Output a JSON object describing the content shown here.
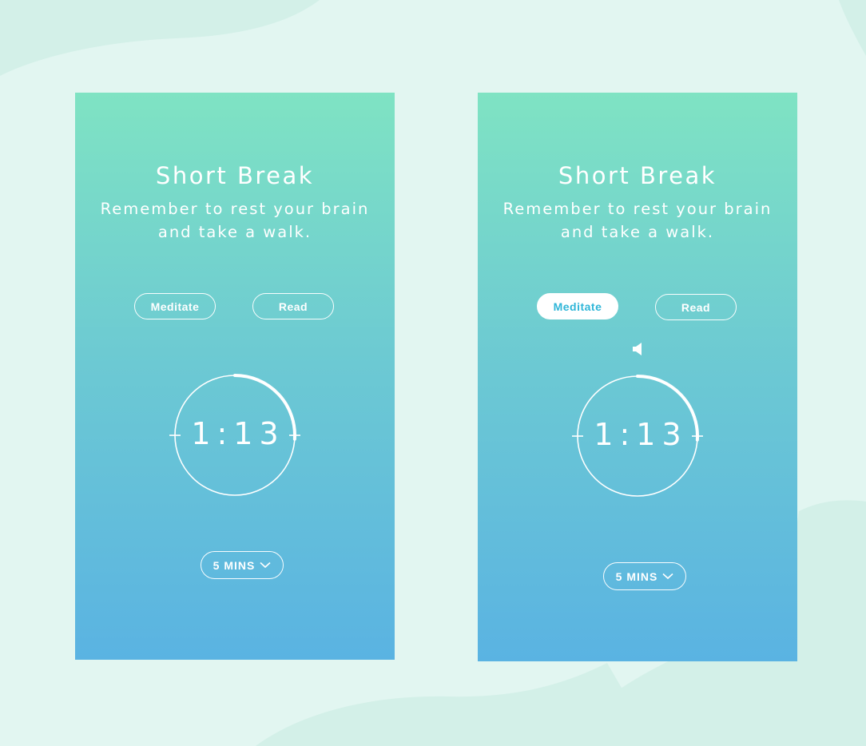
{
  "colors": {
    "page_background": "#e2f6f1",
    "gradient_top": "#7fe3c3",
    "gradient_bottom": "#5ab3e2",
    "active_pill_text": "#2fb6d8",
    "foreground": "#ffffff"
  },
  "screens": [
    {
      "title": "Short Break",
      "subtitle_line1": "Remember to rest your brain",
      "subtitle_line2": "and take a walk.",
      "buttons": [
        {
          "label": "Meditate",
          "active": false
        },
        {
          "label": "Read",
          "active": false
        }
      ],
      "timer": {
        "time": "1:13",
        "progress": 0.26
      },
      "duration": {
        "label": "5 MINS",
        "icon": "chevron-down-icon"
      }
    },
    {
      "title": "Short Break",
      "subtitle_line1": "Remember to rest your brain",
      "subtitle_line2": "and take a walk.",
      "buttons": [
        {
          "label": "Meditate",
          "active": true
        },
        {
          "label": "Read",
          "active": false
        }
      ],
      "sound_icon": "speaker-icon",
      "timer": {
        "time": "1:13",
        "progress": 0.26
      },
      "duration": {
        "label": "5 MINS",
        "icon": "chevron-down-icon"
      }
    }
  ]
}
